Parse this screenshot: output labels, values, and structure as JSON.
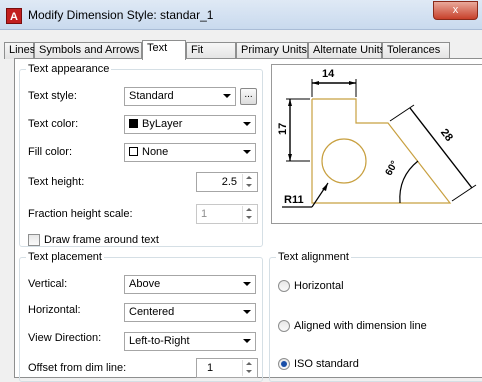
{
  "window": {
    "title": "Modify Dimension Style: standar_1",
    "app_icon": "A",
    "close_label": "x"
  },
  "tabs": [
    {
      "label": "Lines"
    },
    {
      "label": "Symbols and Arrows"
    },
    {
      "label": "Text"
    },
    {
      "label": "Fit"
    },
    {
      "label": "Primary Units"
    },
    {
      "label": "Alternate Units"
    },
    {
      "label": "Tolerances"
    }
  ],
  "text_appearance": {
    "title": "Text appearance",
    "text_style_label": "Text style:",
    "text_style_value": "Standard",
    "dots_label": "...",
    "text_color_label": "Text color:",
    "text_color_value": "ByLayer",
    "text_color_swatch": "#000000",
    "fill_color_label": "Fill color:",
    "fill_color_value": "None",
    "text_height_label": "Text height:",
    "text_height_value": "2.5",
    "fraction_label": "Fraction height scale:",
    "fraction_value": "1",
    "frame_label": "Draw frame around text",
    "frame_checked": false
  },
  "text_placement": {
    "title": "Text placement",
    "vertical_label": "Vertical:",
    "vertical_value": "Above",
    "horizontal_label": "Horizontal:",
    "horizontal_value": "Centered",
    "view_direction_label": "View Direction:",
    "view_direction_value": "Left-to-Right",
    "offset_label": "Offset from dim line:",
    "offset_value": "1"
  },
  "text_alignment": {
    "title": "Text alignment",
    "options": [
      {
        "label": "Horizontal",
        "selected": false
      },
      {
        "label": "Aligned with dimension line",
        "selected": false
      },
      {
        "label": "ISO standard",
        "selected": true
      }
    ]
  },
  "preview": {
    "dim_top": "14",
    "dim_left": "17",
    "dim_right": "28",
    "dim_angle": "60°",
    "leader_label": "R11",
    "line_color": "#c8a040"
  }
}
